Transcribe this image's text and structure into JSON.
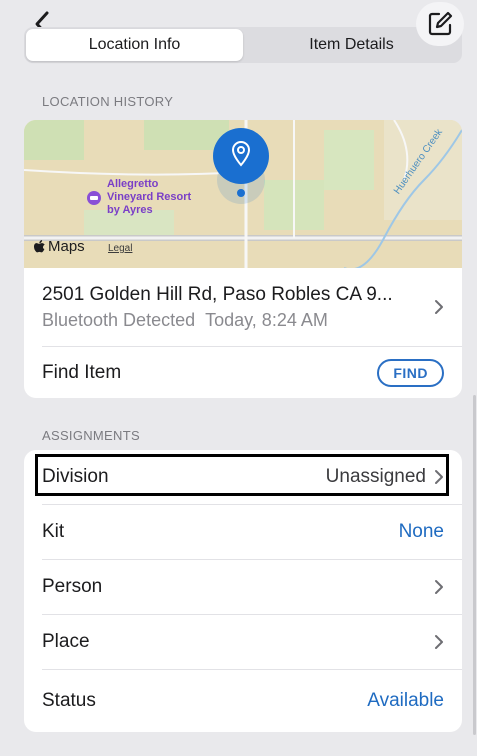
{
  "header": {
    "tabs": [
      {
        "label": "Location Info",
        "active": true
      },
      {
        "label": "Item Details",
        "active": false
      }
    ]
  },
  "location_history": {
    "section_title": "LOCATION HISTORY",
    "map": {
      "poi_name": "Allegretto\nVineyard Resort\nby Ayres",
      "creek_label": "Huerhuero Creek",
      "maps_brand": "Maps",
      "legal_label": "Legal"
    },
    "address": "2501 Golden Hill Rd, Paso Robles CA 9...",
    "detection_method": "Bluetooth Detected",
    "detection_time": "Today, 8:24 AM",
    "find_item_label": "Find Item",
    "find_button_label": "FIND"
  },
  "assignments": {
    "section_title": "ASSIGNMENTS",
    "rows": [
      {
        "label": "Division",
        "value": "Unassigned"
      },
      {
        "label": "Kit",
        "value": "None"
      },
      {
        "label": "Person",
        "value": ""
      },
      {
        "label": "Place",
        "value": ""
      },
      {
        "label": "Status",
        "value": "Available"
      }
    ]
  },
  "colors": {
    "accent": "#1f6bc1",
    "background": "#e9e9ec",
    "card": "#ffffff",
    "pin": "#1a6fd0"
  }
}
